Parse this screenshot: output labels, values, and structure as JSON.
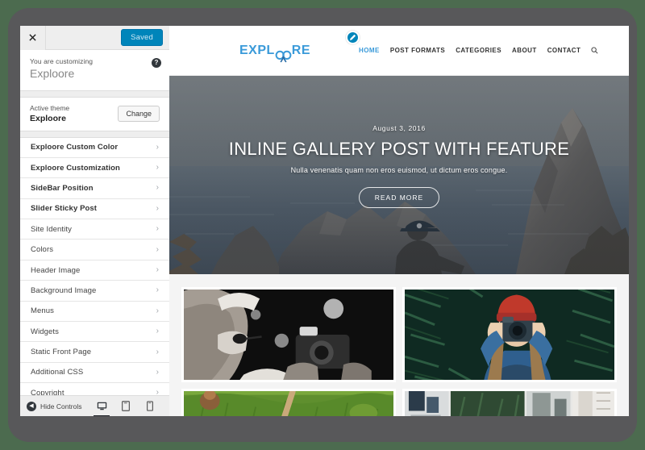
{
  "frame": {
    "background_color": "#4c6b4f",
    "device_color": "#58585a"
  },
  "customizer": {
    "close_icon": "close-icon",
    "save_label": "Saved",
    "help_icon": "?",
    "customizing_label": "You are customizing",
    "site_title": "Exploore",
    "active_theme_label": "Active theme",
    "active_theme_name": "Exploore",
    "change_label": "Change",
    "sections": [
      {
        "label": "Exploore Custom Color",
        "bold": true
      },
      {
        "label": "Exploore Customization",
        "bold": true
      },
      {
        "label": "SideBar Position",
        "bold": true
      },
      {
        "label": "Slider Sticky Post",
        "bold": true
      },
      {
        "label": "Site Identity",
        "bold": false
      },
      {
        "label": "Colors",
        "bold": false
      },
      {
        "label": "Header Image",
        "bold": false
      },
      {
        "label": "Background Image",
        "bold": false
      },
      {
        "label": "Menus",
        "bold": false
      },
      {
        "label": "Widgets",
        "bold": false
      },
      {
        "label": "Static Front Page",
        "bold": false
      },
      {
        "label": "Additional CSS",
        "bold": false
      },
      {
        "label": "Copyright",
        "bold": false
      }
    ],
    "chevron": "›",
    "footer": {
      "hide_controls_label": "Hide Controls",
      "hide_icon": "◀",
      "devices": [
        {
          "name": "desktop",
          "active": true
        },
        {
          "name": "tablet",
          "active": false
        },
        {
          "name": "mobile",
          "active": false
        }
      ]
    }
  },
  "preview": {
    "site_header": {
      "logo_before": "EXPL",
      "logo_oo": "OO",
      "logo_after": "RE",
      "logo_color": "#3a9ad9",
      "edit_badge_icon": "pencil-icon",
      "nav": [
        {
          "label": "HOME",
          "active": true
        },
        {
          "label": "POST FORMATS",
          "active": false
        },
        {
          "label": "CATEGORIES",
          "active": false
        },
        {
          "label": "ABOUT",
          "active": false
        },
        {
          "label": "CONTACT",
          "active": false
        }
      ],
      "search_icon": "search-icon"
    },
    "hero": {
      "date": "August 3, 2016",
      "title": "INLINE GALLERY POST WITH FEATURE",
      "subtitle": "Nulla venenatis quam non eros euismod, ut dictum eros congue.",
      "button_label": "READ MORE"
    },
    "gallery": {
      "rows": [
        [
          {
            "name": "photographer-bw-photo"
          },
          {
            "name": "woman-red-beanie-camera-photo"
          }
        ],
        [
          {
            "name": "green-field-photo"
          },
          {
            "name": "desk-interior-photo"
          }
        ]
      ]
    }
  }
}
